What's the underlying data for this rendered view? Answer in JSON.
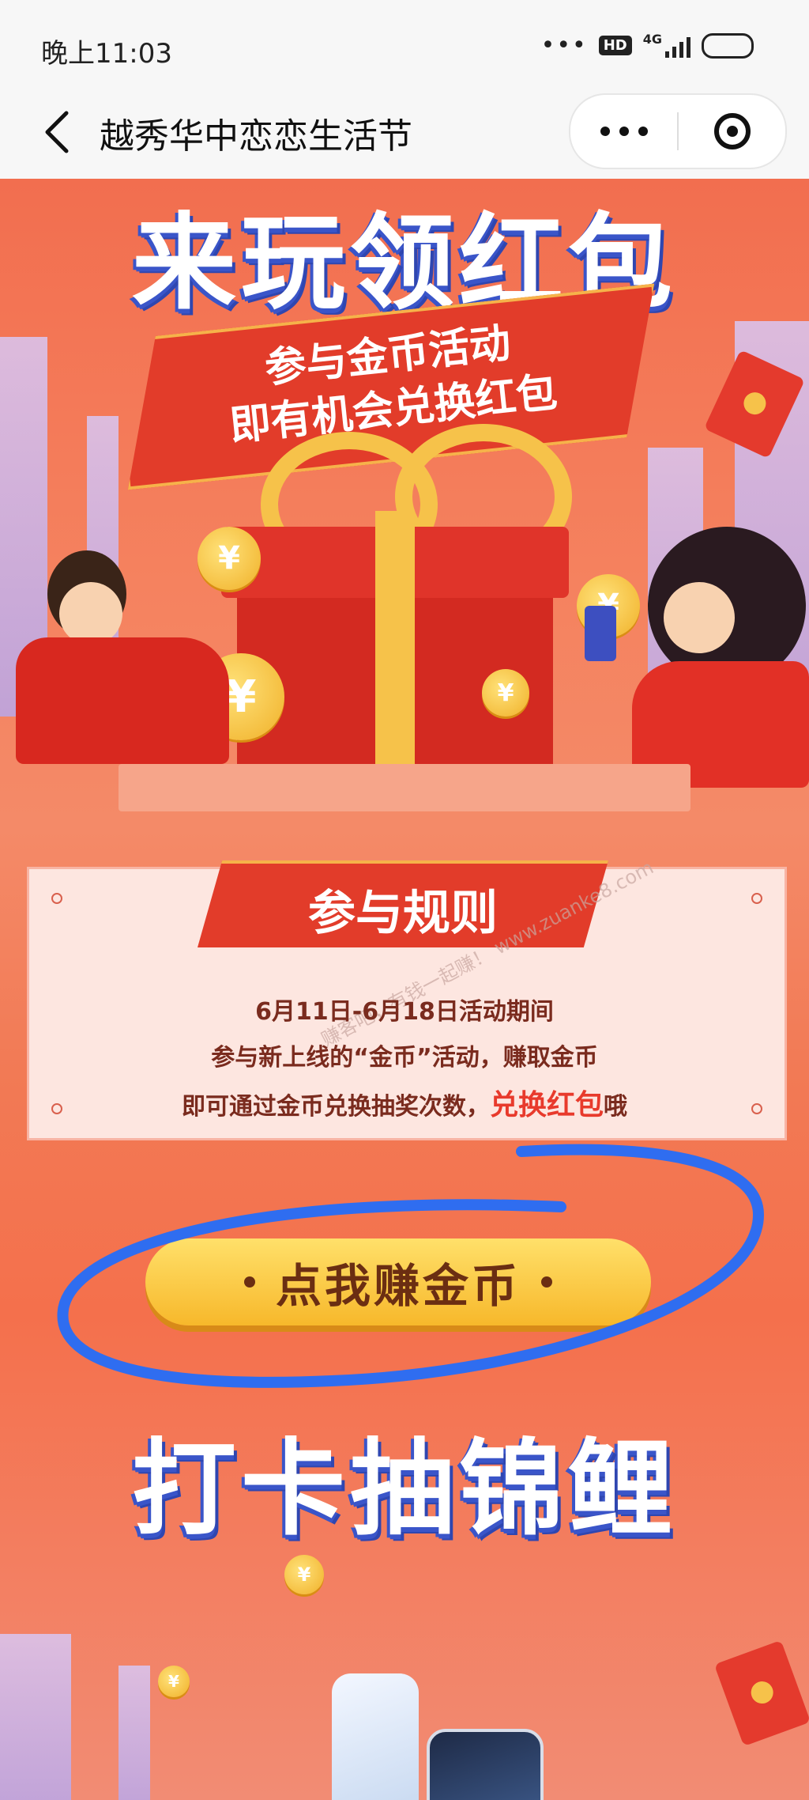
{
  "status_bar": {
    "time": "晚上11:03",
    "hd_label": "HD",
    "network_label": "4G"
  },
  "nav": {
    "title": "越秀华中恋恋生活节"
  },
  "hero": {
    "title": "来玩领红包",
    "subtitle_line1": "参与金币活动",
    "subtitle_line2": "即有机会兑换红包",
    "coin_symbol": "¥"
  },
  "rules": {
    "header": "参与规则",
    "line1": "6月11日-6月18日活动期间",
    "line2": "参与新上线的“金币”活动，赚取金币",
    "line3_prefix": "即可通过金币兑换抽奖次数，",
    "line3_highlight": "兑换红包",
    "line3_suffix": "哦",
    "watermark": "赚客吧，有钱一起赚！ www.zuanke8.com"
  },
  "earn_button": {
    "label": "点我赚金币"
  },
  "koi": {
    "title": "打卡抽锦鲤"
  },
  "colors": {
    "accent_red": "#e23c2a",
    "gold": "#f6c24a",
    "title_blue": "#3a55c9",
    "annotation_blue": "#2f6df0"
  },
  "icons": [
    "back-chevron-icon",
    "more-dots-icon",
    "close-target-icon",
    "signal-icon",
    "battery-icon",
    "coin-icon",
    "red-envelope-icon"
  ]
}
